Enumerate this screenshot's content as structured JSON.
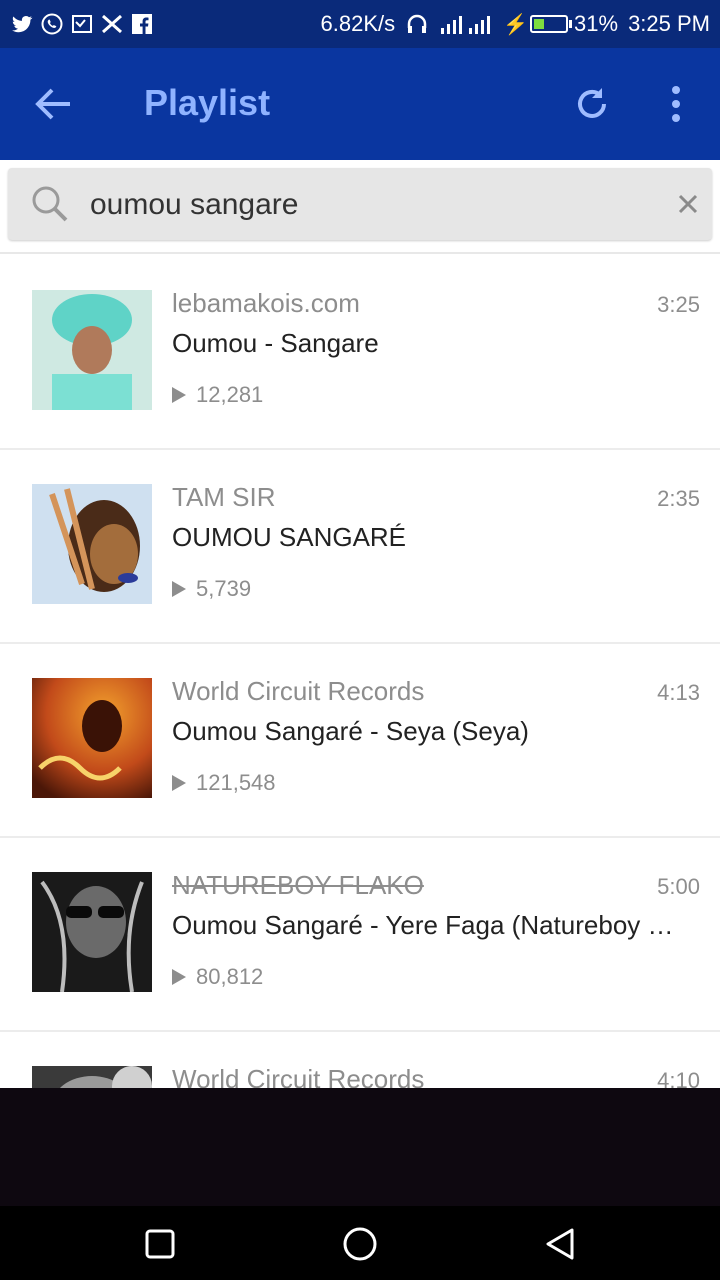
{
  "status": {
    "speed": "6.82K/s",
    "battery": "31%",
    "time": "3:25 PM"
  },
  "app": {
    "title": "Playlist"
  },
  "search": {
    "value": "oumou sangare"
  },
  "items": [
    {
      "channel": "lebamakois.com",
      "title": "Oumou - Sangare",
      "duration": "3:25",
      "views": "12,281",
      "thumb": [
        "#5fd3c7",
        "#7ce0d3",
        "#3aa39a"
      ]
    },
    {
      "channel": "TAM SIR",
      "title": "OUMOU SANGARÉ",
      "duration": "2:35",
      "views": "5,739",
      "thumb": [
        "#a36d3c",
        "#d4945a",
        "#4a2b18"
      ]
    },
    {
      "channel": "World Circuit Records",
      "title": "Oumou Sangaré - Seya (Seya)",
      "duration": "4:13",
      "views": "121,548",
      "thumb": [
        "#f3a12d",
        "#c24a1a",
        "#4b1708"
      ]
    },
    {
      "channel": "NATUREBOY FLAKO",
      "title": "Oumou Sangaré - Yere Faga (Natureboy …",
      "duration": "5:00",
      "views": "80,812",
      "thumb": [
        "#1a1a1a",
        "#6a6a6a",
        "#bdbdbd"
      ]
    },
    {
      "channel": "World Circuit Records",
      "title": "",
      "duration": "4:10",
      "views": "",
      "thumb": [
        "#3a3a3a",
        "#9a9a9a",
        "#d0d0d0"
      ]
    }
  ]
}
